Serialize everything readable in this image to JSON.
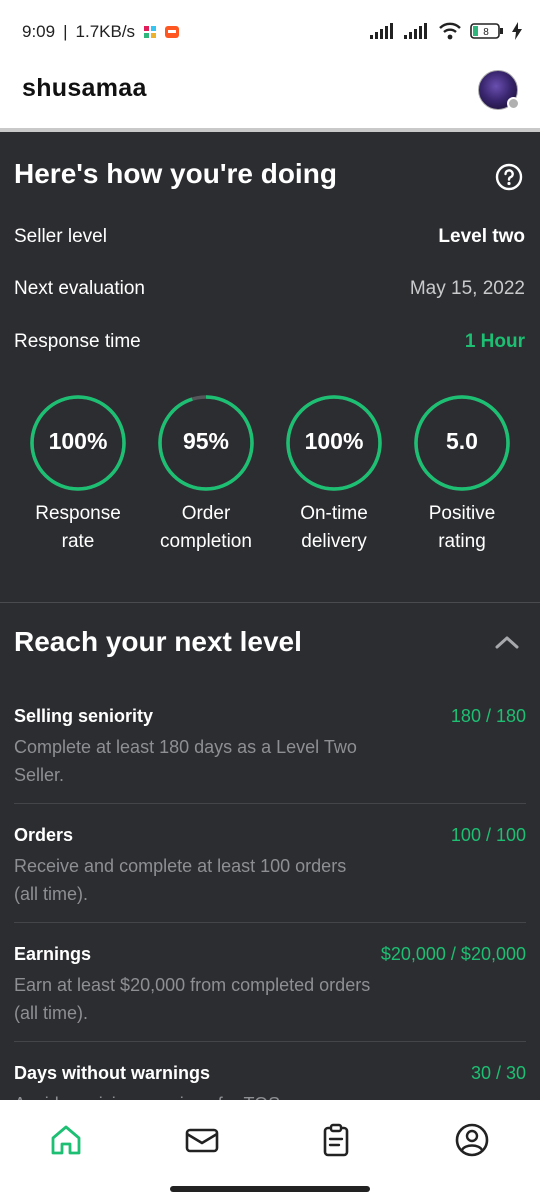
{
  "status_bar": {
    "time": "9:09",
    "network_speed": "1.7KB/s",
    "battery": "8"
  },
  "header": {
    "username": "shusamaa"
  },
  "performance": {
    "title": "Here's how you're doing",
    "rows": [
      {
        "label": "Seller level",
        "value": "Level two",
        "color": "#ffffff"
      },
      {
        "label": "Next evaluation",
        "value": "May 15, 2022",
        "color": "#c9cacc"
      },
      {
        "label": "Response time",
        "value": "1 Hour",
        "color": "#1dbf73"
      }
    ],
    "metrics": [
      {
        "value": "100%",
        "label_line1": "Response",
        "label_line2": "rate",
        "fraction": 1.0
      },
      {
        "value": "95%",
        "label_line1": "Order",
        "label_line2": "completion",
        "fraction": 0.95
      },
      {
        "value": "100%",
        "label_line1": "On-time",
        "label_line2": "delivery",
        "fraction": 1.0
      },
      {
        "value": "5.0",
        "label_line1": "Positive",
        "label_line2": "rating",
        "fraction": 1.0
      }
    ]
  },
  "next_level": {
    "title": "Reach your next level",
    "requirements": [
      {
        "title": "Selling seniority",
        "progress": "180 / 180",
        "desc": "Complete at least 180 days as a Level Two Seller."
      },
      {
        "title": "Orders",
        "progress": "100 / 100",
        "desc": "Receive and complete at least 100 orders (all time)."
      },
      {
        "title": "Earnings",
        "progress": "$20,000 / $20,000",
        "desc": "Earn at least $20,000 from completed orders (all time)."
      },
      {
        "title": "Days without warnings",
        "progress": "30 / 30",
        "desc": "Avoid receiving warnings for TOS"
      }
    ]
  },
  "bottom_nav": {
    "items": [
      {
        "icon": "home-icon",
        "active": true
      },
      {
        "icon": "inbox-icon",
        "active": false
      },
      {
        "icon": "orders-clipboard-icon",
        "active": false
      },
      {
        "icon": "profile-icon",
        "active": false
      }
    ]
  },
  "colors": {
    "accent": "#1dbf73",
    "dark_bg": "#2c2d30",
    "muted": "#8e8f93"
  }
}
